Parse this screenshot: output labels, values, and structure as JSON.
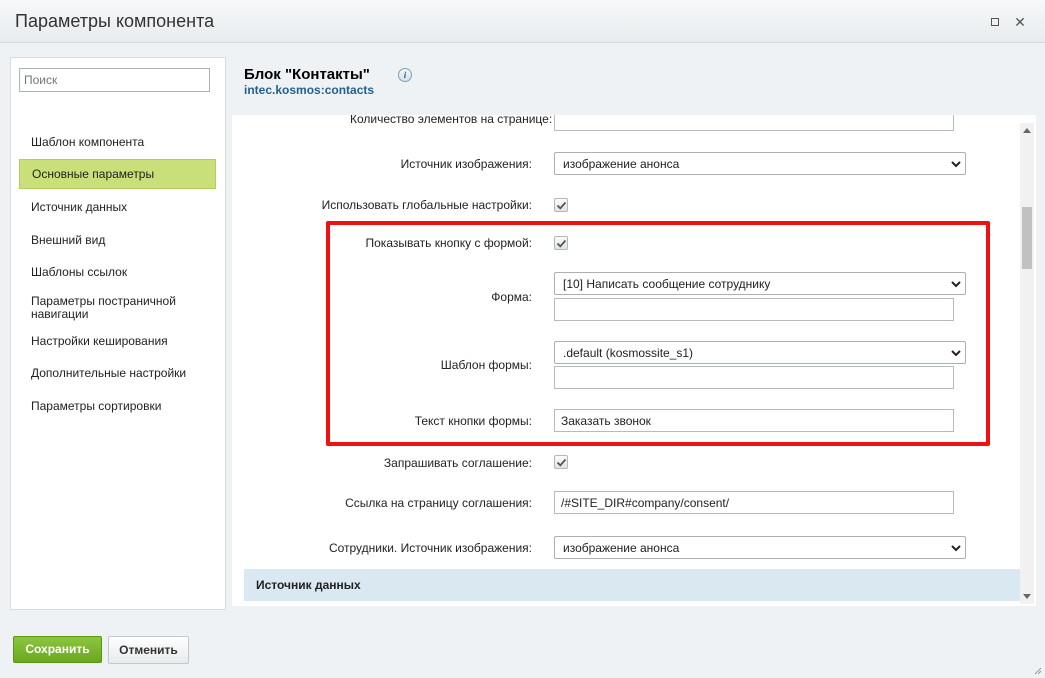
{
  "window": {
    "title": "Параметры компонента"
  },
  "sidebar": {
    "search_placeholder": "Поиск",
    "items": [
      {
        "label": "Шаблон компонента"
      },
      {
        "label": "Основные параметры"
      },
      {
        "label": "Источник данных"
      },
      {
        "label": "Внешний вид"
      },
      {
        "label": "Шаблоны ссылок"
      },
      {
        "label": "Параметры постраничной навигации"
      },
      {
        "label": "Настройки кеширования"
      },
      {
        "label": "Дополнительные настройки"
      },
      {
        "label": "Параметры сортировки"
      }
    ],
    "active_item": "Основные параметры"
  },
  "header": {
    "title": "Блок \"Контакты\"",
    "component_id": "intec.kosmos:contacts",
    "info_icon": "i"
  },
  "params": {
    "cutoff_label": "Количество элементов на странице:",
    "image_source": {
      "label": "Источник изображения:",
      "value": "изображение анонса"
    },
    "global_settings": {
      "label": "Использовать глобальные настройки:",
      "checked": true
    },
    "show_form_button": {
      "label": "Показывать кнопку с формой:",
      "checked": true
    },
    "form": {
      "label": "Форма:",
      "value": "[10] Написать сообщение сотруднику",
      "extra": ""
    },
    "form_template": {
      "label": "Шаблон формы:",
      "value": ".default (kosmossite_s1)",
      "extra": ""
    },
    "form_button_text": {
      "label": "Текст кнопки формы:",
      "value": "Заказать звонок"
    },
    "request_consent": {
      "label": "Запрашивать соглашение:",
      "checked": true
    },
    "consent_url": {
      "label": "Ссылка на страницу соглашения:",
      "value": "/#SITE_DIR#company/consent/"
    },
    "staff_image_source": {
      "label": "Сотрудники. Источник изображения:",
      "value": "изображение анонса"
    }
  },
  "section": {
    "label": "Источник данных"
  },
  "footer": {
    "save_label": "Сохранить",
    "cancel_label": "Отменить"
  },
  "colors": {
    "highlight": "#ee1111",
    "active_nav": "#c8df7a",
    "save_button": "#7ab62f",
    "link": "#235f8f"
  }
}
